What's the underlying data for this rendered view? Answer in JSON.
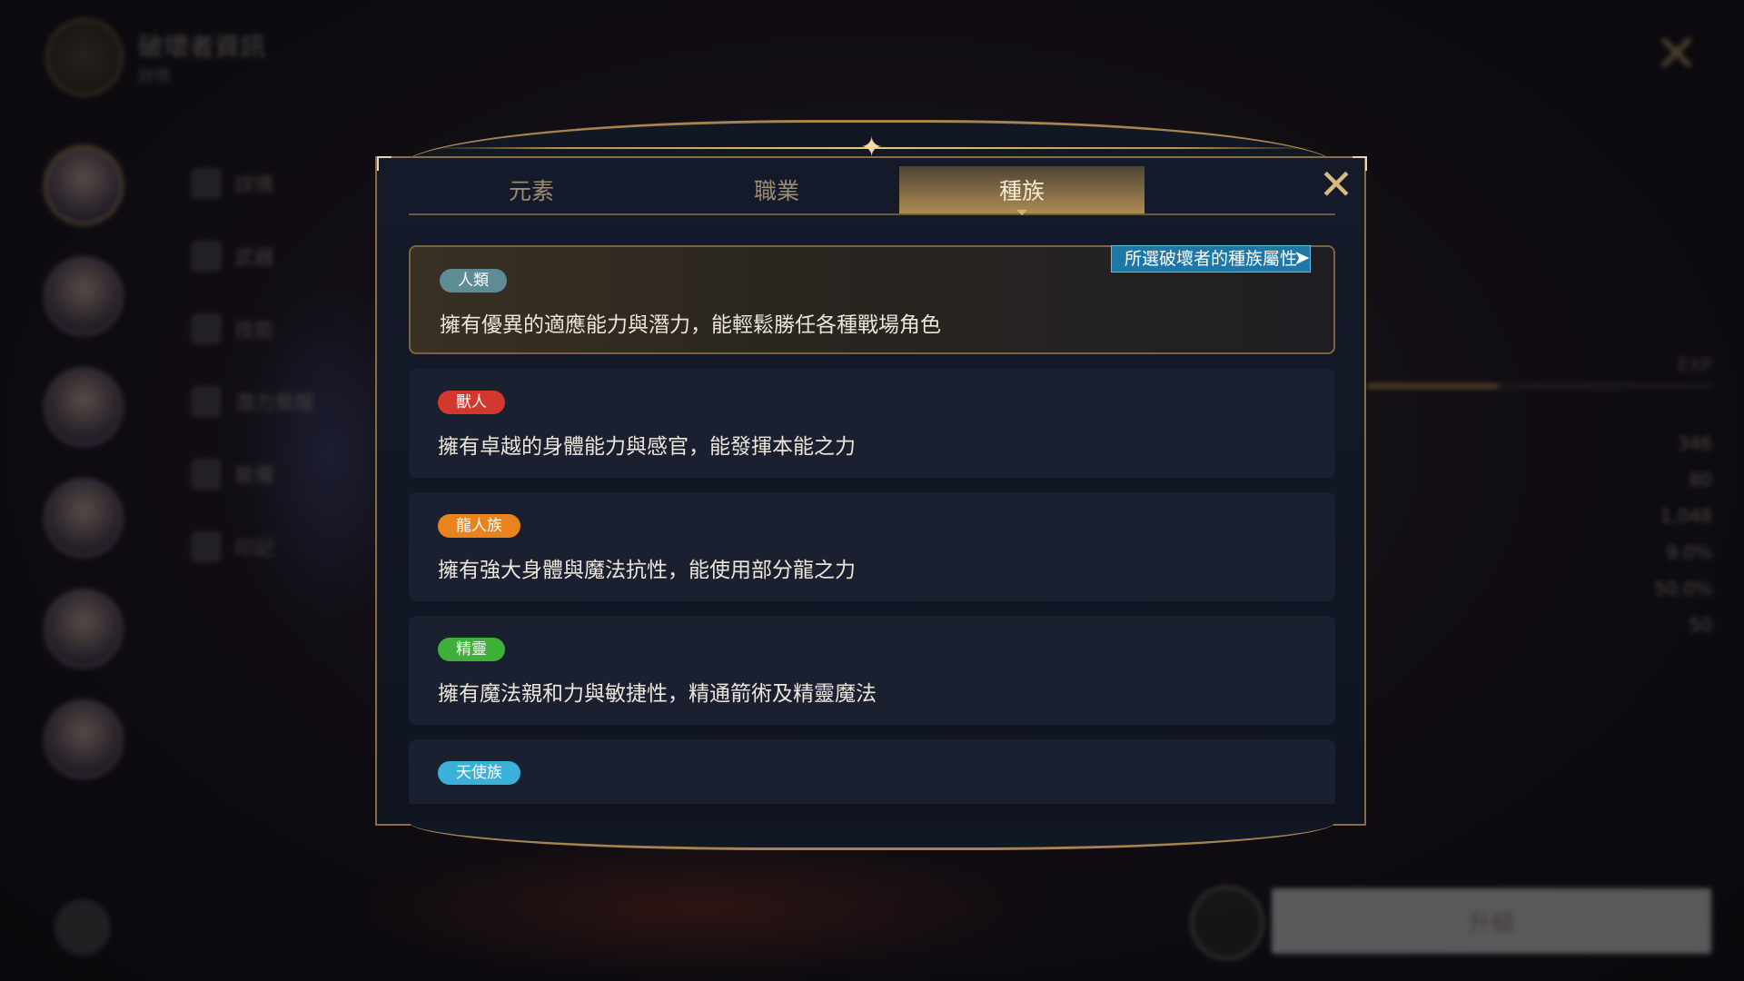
{
  "background": {
    "header_title": "破壞者資訊",
    "header_subtitle": "詳情",
    "menu_items": [
      "詳情",
      "武器",
      "技能",
      "潛力覺醒",
      "裝備",
      "印記"
    ],
    "exp_label": "EXP",
    "stats": [
      "346",
      "80",
      "1,048",
      "9.0%",
      "50.0%",
      "50"
    ],
    "upgrade_label": "升級",
    "close_icon": "crossed-swords-icon"
  },
  "modal": {
    "tabs": [
      {
        "label": "元素",
        "active": false
      },
      {
        "label": "職業",
        "active": false
      },
      {
        "label": "種族",
        "active": true
      }
    ],
    "close_icon": "crossed-swords-close-icon",
    "tooltip": "所選破壞者的種族屬性",
    "races": [
      {
        "name": "人類",
        "color": "#5e8c94",
        "desc": "擁有優異的適應能力與潛力，能輕鬆勝任各種戰場角色",
        "selected": true
      },
      {
        "name": "獸人",
        "color": "#d2382c",
        "desc": "擁有卓越的身體能力與感官，能發揮本能之力",
        "selected": false
      },
      {
        "name": "龍人族",
        "color": "#e8831e",
        "desc": "擁有強大身體與魔法抗性，能使用部分龍之力",
        "selected": false
      },
      {
        "name": "精靈",
        "color": "#3fb03a",
        "desc": "擁有魔法親和力與敏捷性，精通箭術及精靈魔法",
        "selected": false
      },
      {
        "name": "天使族",
        "color": "#3bb0d8",
        "desc": "",
        "selected": false
      }
    ]
  }
}
